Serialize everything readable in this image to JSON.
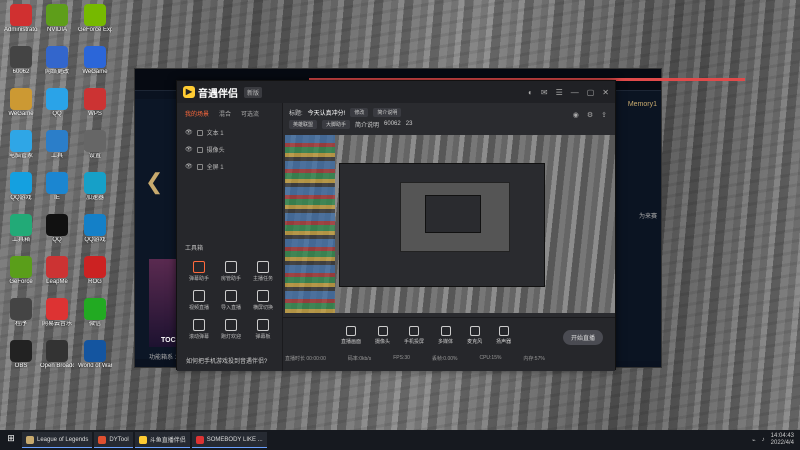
{
  "desktop": {
    "icons": [
      {
        "label": "Administrator",
        "color": "#d03030"
      },
      {
        "label": "NVIDIA",
        "color": "#5e9e1a"
      },
      {
        "label": "GeForce Experience",
        "color": "#76b900"
      },
      {
        "label": "60062",
        "color": "#444"
      },
      {
        "label": "网络更改",
        "color": "#3366cc"
      },
      {
        "label": "WeGame",
        "color": "#2b66d9"
      },
      {
        "label": "WeGame",
        "color": "#c93"
      },
      {
        "label": "QQ",
        "color": "#2aa3e8"
      },
      {
        "label": "WPS",
        "color": "#c33"
      },
      {
        "label": "电脑管家",
        "color": "#2fa6e6"
      },
      {
        "label": "工具",
        "color": "#2b7ec9"
      },
      {
        "label": "设置",
        "color": "#666"
      },
      {
        "label": "QQ游戏",
        "color": "#14a0e0"
      },
      {
        "label": "IE",
        "color": "#1b86d1"
      },
      {
        "label": "加速器",
        "color": "#16a0c8"
      },
      {
        "label": "工具箱",
        "color": "#2a7"
      },
      {
        "label": "QQ",
        "color": "#111"
      },
      {
        "label": "QQ游戏",
        "color": "#1480c8"
      },
      {
        "label": "GeForce",
        "color": "#5a9e1a"
      },
      {
        "label": "LeapMe",
        "color": "#c33"
      },
      {
        "label": "ROG",
        "color": "#c22"
      },
      {
        "label": "程序",
        "color": "#444"
      },
      {
        "label": "网易云音乐",
        "color": "#d33"
      },
      {
        "label": "微信",
        "color": "#2a2"
      },
      {
        "label": "OBS",
        "color": "#222"
      },
      {
        "label": "Open Broadcaster",
        "color": "#333"
      },
      {
        "label": "World of Warcraft",
        "color": "#1455a0"
      }
    ]
  },
  "lol": {
    "player": "Memory1",
    "side_text": "为来赛",
    "toc": "TOC",
    "bottom": "功能箱系 1"
  },
  "app": {
    "logo": "音遇伴侣",
    "version": "新版",
    "tabs": [
      "我的场景",
      "混合",
      "可选流"
    ],
    "scenes": [
      "文本 1",
      "摄像头",
      "全屏 1"
    ],
    "tools_title": "工具箱",
    "tools": [
      "弹幕助手",
      "房管助手",
      "主播任务",
      "视频直播",
      "导入直播",
      "横屏切换",
      "滚动弹幕",
      "跑灯欢迎",
      "弹幕板",
      "语音直播",
      "抽奖",
      "更多"
    ],
    "head_row1": [
      "标题:",
      "今天认真冲分!",
      "修改",
      "简介说明"
    ],
    "head_row2": [
      "英雄联盟",
      "大脚助手",
      "简介说明",
      "60062",
      "23"
    ],
    "controls": [
      "直播画面",
      "摄像头",
      "手机投屏",
      "多媒体",
      "麦克风",
      "扬声器"
    ],
    "start_btn": "开始直播",
    "status": [
      "直播时长 00:00:00",
      "码率:0kb/s",
      "FPS:30",
      "丢帧:0.00%",
      "CPU:15%",
      "内存:57%"
    ]
  },
  "notice": "如何把手机游戏投到音遇伴侣?",
  "taskbar": {
    "items": [
      "League of Legends",
      "DYTool",
      "斗鱼直播伴侣",
      "SOMEBODY LIKE ..."
    ],
    "time": "14:04:43",
    "date": "2022/4/4"
  }
}
